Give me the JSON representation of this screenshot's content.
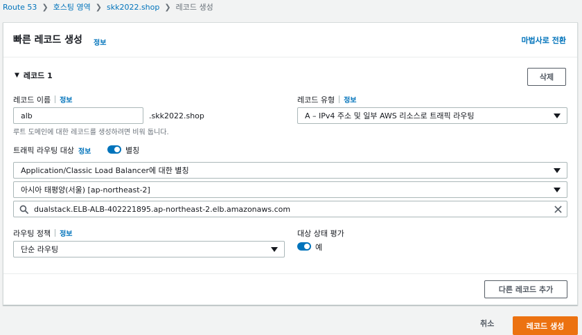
{
  "breadcrumb": {
    "items": [
      "Route 53",
      "호스팅 영역",
      "skk2022.shop",
      "레코드 생성"
    ]
  },
  "panel": {
    "title": "빠른 레코드 생성",
    "info": "정보",
    "wizard_link": "마법사로 전환"
  },
  "record": {
    "heading": "레코드 1",
    "delete_label": "삭제",
    "name": {
      "label": "레코드 이름",
      "info": "정보",
      "value": "alb",
      "suffix": ".skk2022.shop",
      "hint": "루트 도메인에 대한 레코드를 생성하려면 비워 둡니다."
    },
    "type": {
      "label": "레코드 유형",
      "info": "정보",
      "value": "A – IPv4 주소 및 일부 AWS 리소스로 트래픽 라우팅"
    },
    "traffic": {
      "label": "트래픽 라우팅 대상",
      "info": "정보",
      "toggle_label": "별칭",
      "toggle_on": true,
      "target_type": "Application/Classic Load Balancer에 대한 별칭",
      "region": "아시아 태평양(서울) [ap-northeast-2]",
      "endpoint": "dualstack.ELB-ALB-402221895.ap-northeast-2.elb.amazonaws.com"
    },
    "routing_policy": {
      "label": "라우팅 정책",
      "info": "정보",
      "value": "단순 라우팅"
    },
    "health": {
      "label": "대상 상태 평가",
      "toggle_label": "예",
      "toggle_on": true
    },
    "add_record_label": "다른 레코드 추가"
  },
  "footer": {
    "cancel_label": "취소",
    "create_label": "레코드 생성"
  },
  "colors": {
    "link": "#0073bb",
    "primary": "#ec7211",
    "toggle_on": "#0073bb",
    "background": "#f2f3f3"
  }
}
